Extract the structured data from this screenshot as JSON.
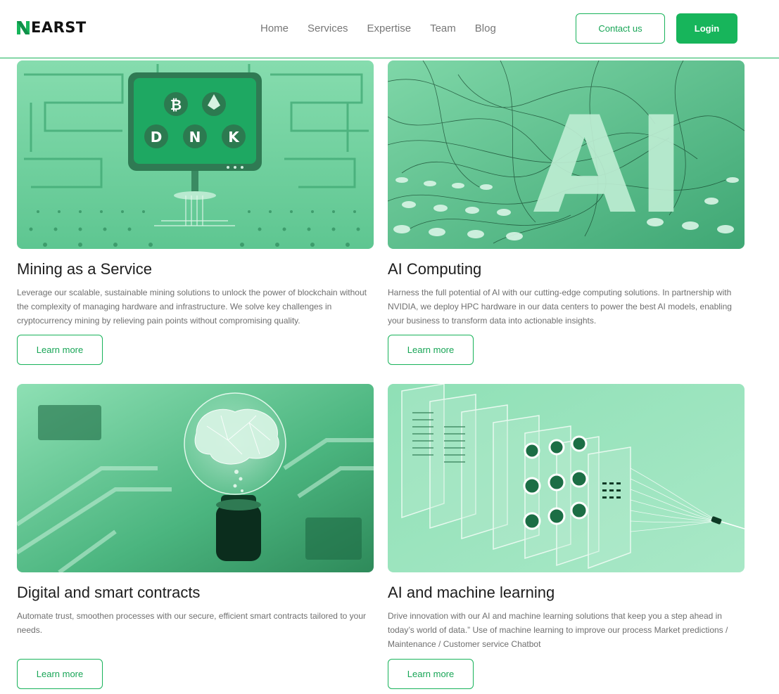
{
  "brand": {
    "name": "EARST",
    "logo_mark": "N"
  },
  "nav": {
    "items": [
      {
        "label": "Home"
      },
      {
        "label": "Services"
      },
      {
        "label": "Expertise"
      },
      {
        "label": "Team"
      },
      {
        "label": "Blog"
      }
    ]
  },
  "header": {
    "contact_label": "Contact us",
    "login_label": "Login"
  },
  "colors": {
    "accent": "#17b55b",
    "image_tint": "#6fd39c"
  },
  "cards": [
    {
      "title": "Mining as a Service",
      "description": "Leverage our scalable, sustainable mining solutions to unlock the power of blockchain without the complexity of managing hardware and infrastructure. We solve key challenges in cryptocurrency mining by relieving pain points without compromising quality.",
      "button": "Learn more",
      "image_icons": [
        "B",
        "D",
        "N",
        "K"
      ]
    },
    {
      "title": "AI Computing",
      "description": "Harness the full potential of AI with our cutting-edge computing solutions. In partnership with NVIDIA, we deploy HPC hardware in our data centers to power the best AI models, enabling your business to transform data into actionable insights.",
      "button": "Learn more",
      "image_text": "AI"
    },
    {
      "title": "Digital and smart contracts",
      "description": "Automate trust, smoothen processes with our secure, efficient smart contracts tailored to your needs.",
      "button": "Learn more"
    },
    {
      "title": "AI and machine learning",
      "description": "Drive innovation with our AI and machine learning solutions that keep you a step ahead in today’s world of data.” Use of machine learning to improve our process Market predictions / Maintenance / Customer service Chatbot",
      "button": "Learn more"
    }
  ]
}
